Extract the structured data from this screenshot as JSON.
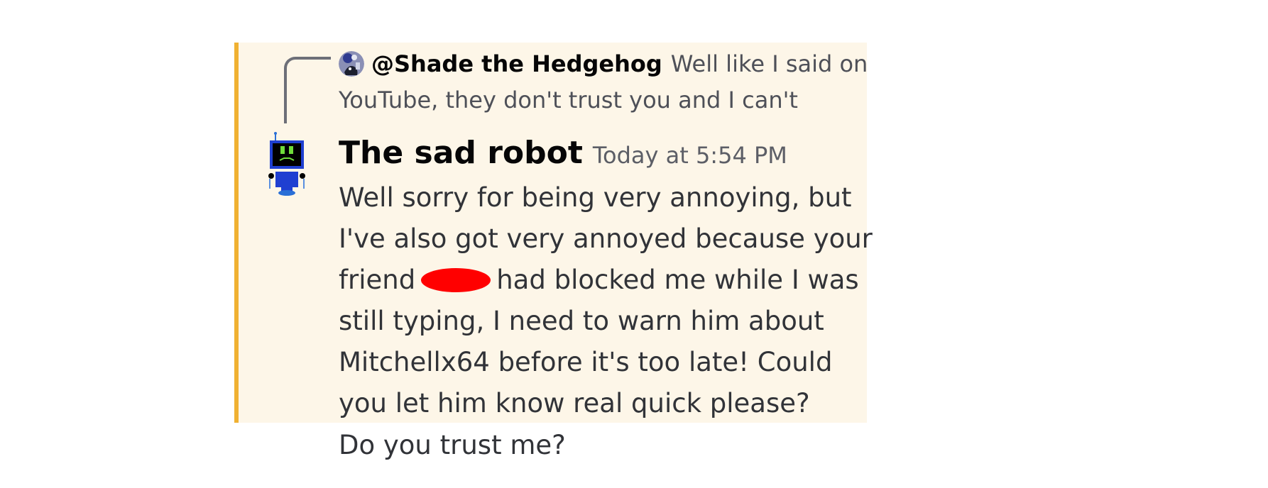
{
  "colors": {
    "mention_highlight_bg": "#fdf6e8",
    "mention_bar": "#f0b132",
    "redaction": "#ff0000",
    "text_primary": "#313338",
    "text_muted": "#4e5058"
  },
  "reply": {
    "avatar_icon": "hedgehog-avatar-icon",
    "author": "@Shade the Hedgehog",
    "preview_line1": "Well like I said on",
    "preview_line2": "YouTube, they don't trust you and I can't"
  },
  "message": {
    "avatar_icon": "sad-robot-avatar-icon",
    "author": "The sad robot",
    "timestamp": "Today at 5:54 PM",
    "lines": {
      "l1": "Well sorry for being very annoying, but",
      "l2": "I've also got very annoyed because your",
      "l3a": "friend",
      "l3b": "had blocked me while I was",
      "l4": "still typing, I need to warn him about",
      "l5": "Mitchellx64 before it's too late! Could",
      "l6": "you let him know real quick please?"
    }
  },
  "followup": {
    "text": "Do you trust me?"
  }
}
